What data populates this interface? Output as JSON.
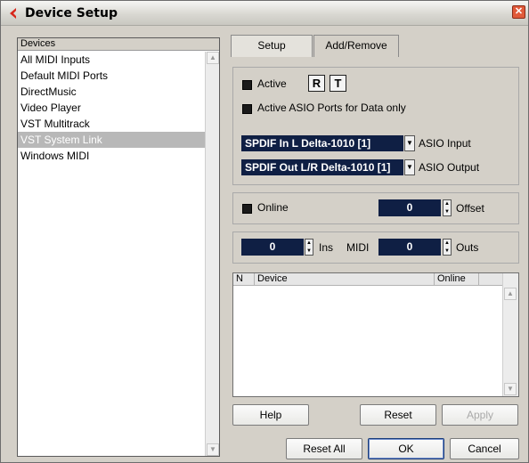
{
  "window": {
    "title": "Device Setup",
    "close_glyph": "✕"
  },
  "device_list": {
    "header": "Devices",
    "items": [
      {
        "label": "All MIDI Inputs",
        "selected": false
      },
      {
        "label": "Default MIDI Ports",
        "selected": false
      },
      {
        "label": "DirectMusic",
        "selected": false
      },
      {
        "label": "Video Player",
        "selected": false
      },
      {
        "label": "VST Multitrack",
        "selected": false
      },
      {
        "label": "VST System Link",
        "selected": true
      },
      {
        "label": "Windows MIDI",
        "selected": false
      }
    ]
  },
  "tabs": [
    {
      "label": "Setup",
      "active": true
    },
    {
      "label": "Add/Remove",
      "active": false
    }
  ],
  "setup": {
    "active_label": "Active",
    "r_label": "R",
    "t_label": "T",
    "asio_data_label": "Active ASIO Ports for Data only",
    "asio_input_value": "SPDIF In L Delta-1010 [1]",
    "asio_input_label": "ASIO Input",
    "asio_output_value": "SPDIF Out L/R Delta-1010 [1]",
    "asio_output_label": "ASIO Output",
    "online_label": "Online",
    "offset_value": "0",
    "offset_label": "Offset",
    "ins_value": "0",
    "ins_label": "Ins",
    "midi_label": "MIDI",
    "outs_value": "0",
    "outs_label": "Outs"
  },
  "table": {
    "columns": [
      "N",
      "Device",
      "Online"
    ]
  },
  "buttons": {
    "help": "Help",
    "reset": "Reset",
    "apply": "Apply",
    "reset_all": "Reset All",
    "ok": "OK",
    "cancel": "Cancel"
  },
  "colors": {
    "field_bg": "#0f1f44",
    "selection": "#b8b8b8",
    "title_icon": "#d7271c"
  }
}
